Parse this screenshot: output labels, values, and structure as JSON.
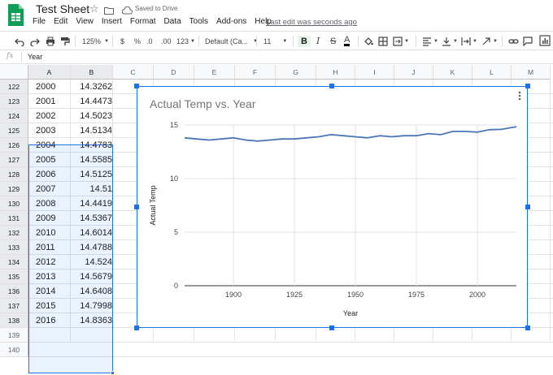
{
  "document": {
    "title": "Test Sheet",
    "saved_status": "Saved to Drive",
    "last_edit": "Last edit was seconds ago"
  },
  "menu": [
    "File",
    "Edit",
    "View",
    "Insert",
    "Format",
    "Data",
    "Tools",
    "Add-ons",
    "Help"
  ],
  "toolbar": {
    "zoom": "125%",
    "currency": "$",
    "percent": "%",
    "decrease_decimals": ".0",
    "increase_decimals": ".00",
    "more_formats": "123",
    "font": "Default (Ca...",
    "font_size": "11",
    "bold": "B",
    "italic": "I",
    "strikethrough": "S",
    "text_color": "A"
  },
  "formula_bar": {
    "fx": "fx",
    "value": "Year"
  },
  "columns": [
    "A",
    "B",
    "C",
    "D",
    "E",
    "F",
    "G",
    "H",
    "I",
    "J",
    "K",
    "L",
    "M"
  ],
  "rows": [
    {
      "num": "122",
      "year": "2000",
      "temp": "14.3262"
    },
    {
      "num": "123",
      "year": "2001",
      "temp": "14.4473"
    },
    {
      "num": "124",
      "year": "2002",
      "temp": "14.5023"
    },
    {
      "num": "125",
      "year": "2003",
      "temp": "14.5134"
    },
    {
      "num": "126",
      "year": "2004",
      "temp": "14.4783"
    },
    {
      "num": "127",
      "year": "2005",
      "temp": "14.5585"
    },
    {
      "num": "128",
      "year": "2006",
      "temp": "14.5125"
    },
    {
      "num": "129",
      "year": "2007",
      "temp": "14.51"
    },
    {
      "num": "130",
      "year": "2008",
      "temp": "14.4419"
    },
    {
      "num": "131",
      "year": "2009",
      "temp": "14.5367"
    },
    {
      "num": "132",
      "year": "2010",
      "temp": "14.6014"
    },
    {
      "num": "133",
      "year": "2011",
      "temp": "14.4788"
    },
    {
      "num": "134",
      "year": "2012",
      "temp": "14.524"
    },
    {
      "num": "135",
      "year": "2013",
      "temp": "14.5679"
    },
    {
      "num": "136",
      "year": "2014",
      "temp": "14.6408"
    },
    {
      "num": "137",
      "year": "2015",
      "temp": "14.7998"
    },
    {
      "num": "138",
      "year": "2016",
      "temp": "14.8363"
    },
    {
      "num": "139",
      "year": "",
      "temp": ""
    },
    {
      "num": "140",
      "year": "",
      "temp": ""
    }
  ],
  "colors": {
    "accent": "#1a73e8",
    "line": "#4a76b9",
    "gridline": "#e0e0e0",
    "sheets_green": "#0f9d58"
  },
  "chart_data": {
    "type": "line",
    "title": "Actual Temp vs. Year",
    "xlabel": "Year",
    "ylabel": "Actual Temp",
    "xlim": [
      1880,
      2016
    ],
    "ylim": [
      0,
      15
    ],
    "xticks": [
      1900,
      1925,
      1950,
      1975,
      2000
    ],
    "yticks": [
      0,
      5,
      10,
      15
    ],
    "grid": true,
    "x": [
      1880,
      1885,
      1890,
      1895,
      1900,
      1905,
      1910,
      1915,
      1920,
      1925,
      1930,
      1935,
      1940,
      1945,
      1950,
      1955,
      1960,
      1965,
      1970,
      1975,
      1980,
      1985,
      1990,
      1995,
      2000,
      2005,
      2010,
      2016
    ],
    "values": [
      13.8,
      13.7,
      13.6,
      13.7,
      13.8,
      13.6,
      13.5,
      13.6,
      13.7,
      13.7,
      13.8,
      13.9,
      14.1,
      14.0,
      13.9,
      13.8,
      14.0,
      13.9,
      14.0,
      14.0,
      14.2,
      14.1,
      14.4,
      14.4,
      14.33,
      14.56,
      14.6,
      14.84
    ]
  }
}
